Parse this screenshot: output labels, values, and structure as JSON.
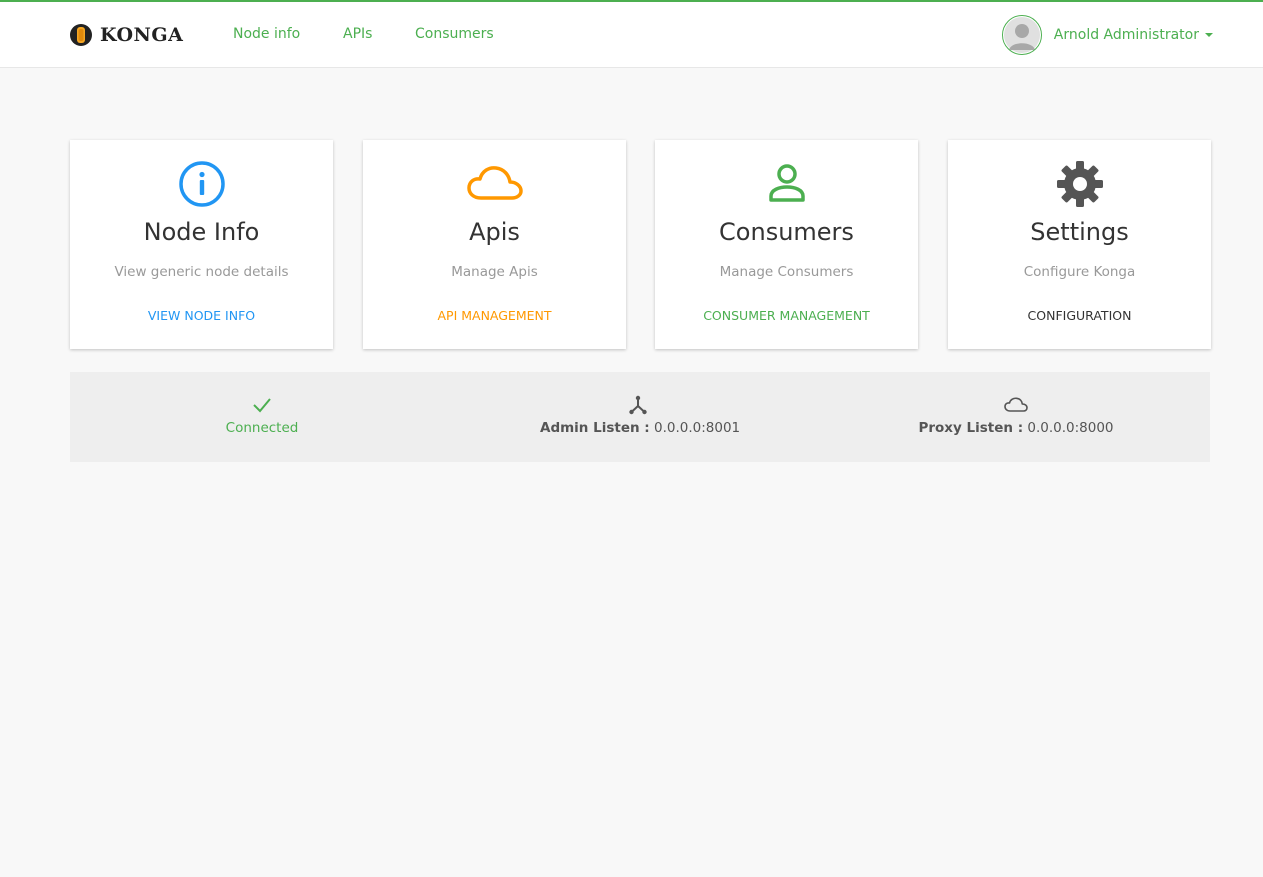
{
  "brand": {
    "name": "KONGA"
  },
  "nav": {
    "items": [
      {
        "label": "Node info"
      },
      {
        "label": "APIs"
      },
      {
        "label": "Consumers"
      }
    ]
  },
  "user": {
    "name": "Arnold Administrator"
  },
  "cards": [
    {
      "icon": "info-icon",
      "title": "Node Info",
      "description": "View generic node details",
      "link": "VIEW NODE INFO",
      "color": "#2196f3"
    },
    {
      "icon": "cloud-icon",
      "title": "Apis",
      "description": "Manage Apis",
      "link": "API MANAGEMENT",
      "color": "#ff9800"
    },
    {
      "icon": "user-icon",
      "title": "Consumers",
      "description": "Manage Consumers",
      "link": "CONSUMER MANAGEMENT",
      "color": "#4caf50"
    },
    {
      "icon": "gear-icon",
      "title": "Settings",
      "description": "Configure Konga",
      "link": "CONFIGURATION",
      "color": "#555555"
    }
  ],
  "status": {
    "connection": {
      "icon": "checkmark-icon",
      "label": "Connected",
      "color": "#4caf50"
    },
    "admin_listen": {
      "icon": "network-icon",
      "label": "Admin Listen :",
      "value": "0.0.0.0:8001"
    },
    "proxy_listen": {
      "icon": "cloud-outline-icon",
      "label": "Proxy Listen :",
      "value": "0.0.0.0:8000"
    }
  },
  "colors": {
    "accent": "#4caf50",
    "background": "#f8f8f8",
    "status_bar": "#eeeeee"
  }
}
